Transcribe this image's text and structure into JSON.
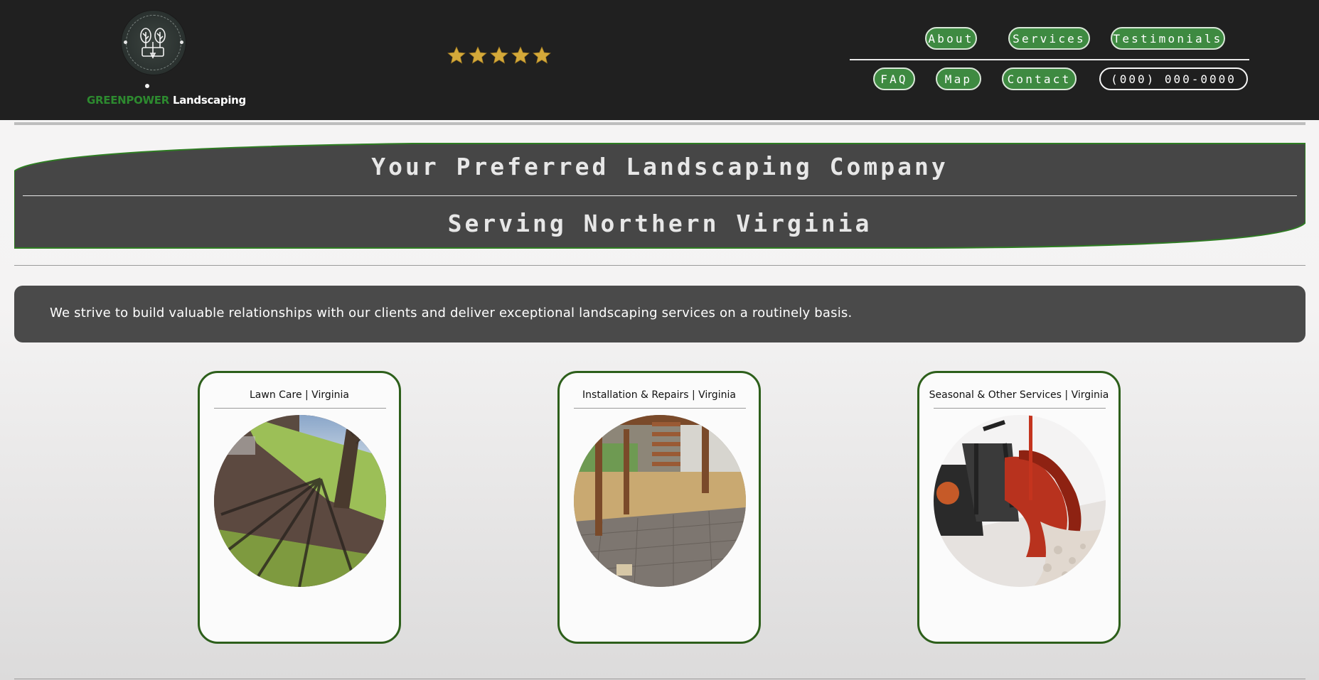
{
  "brand": {
    "name_green": "GREENPOWER",
    "name_white": "Landscaping",
    "logo_ring_text": "GREENPOWER LANDSCAPING",
    "green_color": "#2d8a2f"
  },
  "rating": {
    "stars": 5,
    "max": 5,
    "star_color": "#d4a93a"
  },
  "nav": {
    "items": [
      {
        "label": "About"
      },
      {
        "label": "Services"
      },
      {
        "label": "Testimonials"
      },
      {
        "label": "FAQ"
      },
      {
        "label": "Map"
      },
      {
        "label": "Contact"
      }
    ],
    "phone": "(000) 000-0000",
    "accent": "#3e8a41"
  },
  "hero": {
    "title": "Your Preferred Landscaping Company",
    "subtitle": "Serving Northern Virginia"
  },
  "intro": {
    "text": "We strive to build valuable relationships with our clients and deliver exceptional landscaping services on a routinely basis."
  },
  "services": [
    {
      "title": "Lawn Care | Virginia",
      "image": "lawn-photo"
    },
    {
      "title": "Installation & Repairs | Virginia",
      "image": "patio-photo"
    },
    {
      "title": "Seasonal & Other Services | Virginia",
      "image": "snowplow-photo"
    }
  ]
}
